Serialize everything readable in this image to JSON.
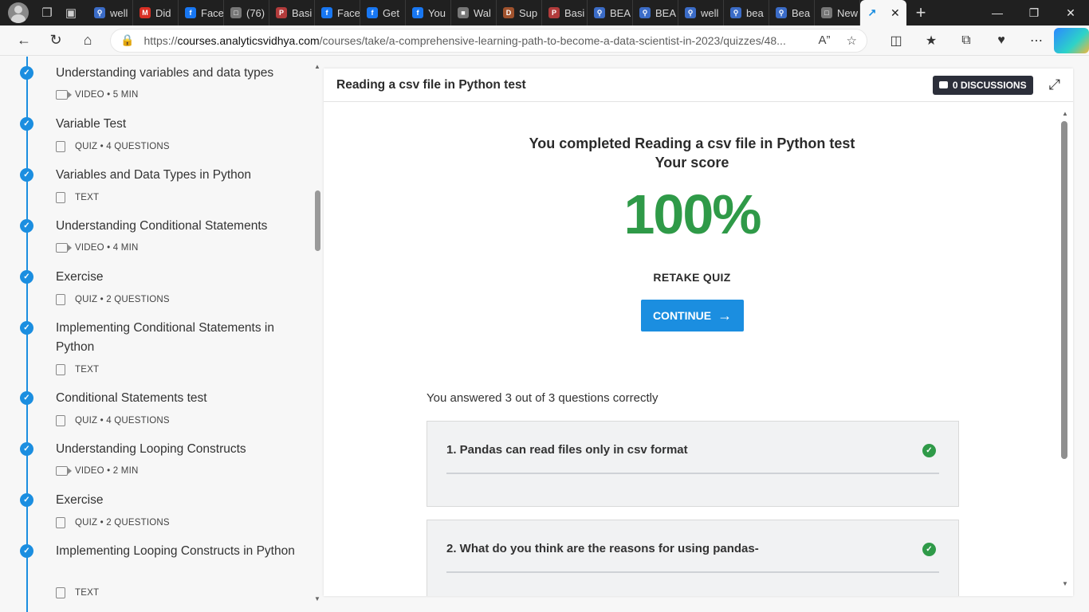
{
  "browser": {
    "tabs": [
      {
        "label": "well",
        "icon": "search-favicon",
        "color": "#3b6cc7"
      },
      {
        "label": "Did",
        "icon": "gmail-favicon",
        "color": "#d93025"
      },
      {
        "label": "Face",
        "icon": "facebook-favicon",
        "color": "#1877f2"
      },
      {
        "label": "(76)",
        "icon": "page-favicon",
        "color": "#777777"
      },
      {
        "label": "Basi",
        "icon": "pdf-favicon",
        "color": "#b23b3b"
      },
      {
        "label": "Face",
        "icon": "facebook-favicon",
        "color": "#1877f2"
      },
      {
        "label": "Get",
        "icon": "facebook-favicon",
        "color": "#1877f2"
      },
      {
        "label": "You",
        "icon": "facebook-favicon",
        "color": "#1877f2"
      },
      {
        "label": "Wal",
        "icon": "briefcase-favicon",
        "color": "#777777"
      },
      {
        "label": "Sup",
        "icon": "app-favicon",
        "color": "#a0522d"
      },
      {
        "label": "Basi",
        "icon": "pdf-favicon",
        "color": "#b23b3b"
      },
      {
        "label": "BEA",
        "icon": "search-favicon",
        "color": "#3b6cc7"
      },
      {
        "label": "BEA",
        "icon": "search-favicon",
        "color": "#3b6cc7"
      },
      {
        "label": "well",
        "icon": "search-favicon",
        "color": "#3b6cc7"
      },
      {
        "label": "bea",
        "icon": "search-favicon",
        "color": "#3b6cc7"
      },
      {
        "label": "Bea",
        "icon": "search-favicon",
        "color": "#3b6cc7"
      },
      {
        "label": "New",
        "icon": "newtab-favicon",
        "color": "#777777"
      }
    ],
    "active_tab_icon": "analyticsvidhya-favicon",
    "url_prefix": "https://",
    "url_host": "courses.analyticsvidhya.com",
    "url_path": "/courses/take/a-comprehensive-learning-path-to-become-a-data-scientist-in-2023/quizzes/48..."
  },
  "sidebar": {
    "lessons": [
      {
        "title": "Understanding variables and data types",
        "meta": "VIDEO • 5 MIN",
        "type": "video"
      },
      {
        "title": "Variable Test",
        "meta": "QUIZ • 4 QUESTIONS",
        "type": "quiz"
      },
      {
        "title": "Variables and Data Types in Python",
        "meta": "TEXT",
        "type": "text"
      },
      {
        "title": "Understanding Conditional Statements",
        "meta": "VIDEO • 4 MIN",
        "type": "video"
      },
      {
        "title": "Exercise",
        "meta": "QUIZ • 2 QUESTIONS",
        "type": "quiz"
      },
      {
        "title": "Implementing Conditional Statements in Python",
        "meta": "TEXT",
        "type": "text"
      },
      {
        "title": "Conditional Statements test",
        "meta": "QUIZ • 4 QUESTIONS",
        "type": "quiz"
      },
      {
        "title": "Understanding Looping Constructs",
        "meta": "VIDEO • 2 MIN",
        "type": "video"
      },
      {
        "title": "Exercise",
        "meta": "QUIZ • 2 QUESTIONS",
        "type": "quiz"
      },
      {
        "title": "Implementing Looping Constructs in Python",
        "meta": "TEXT",
        "type": "text"
      }
    ]
  },
  "main": {
    "title": "Reading a csv file in Python test",
    "discussions_label": "0 DISCUSSIONS",
    "completed_text": "You completed Reading a csv file in Python test",
    "your_score_label": "Your score",
    "score": "100%",
    "retake_label": "RETAKE QUIZ",
    "continue_label": "CONTINUE",
    "answered_text": "You answered 3 out of 3 questions correctly",
    "questions": [
      {
        "text": "1. Pandas can read files only in csv format",
        "correct": true
      },
      {
        "text": "2. What do you think are the reasons for using pandas-",
        "correct": true
      }
    ]
  },
  "colors": {
    "accent": "#1b8ee0",
    "success": "#2f9a48",
    "discussions_bg": "#2c2f3a"
  }
}
